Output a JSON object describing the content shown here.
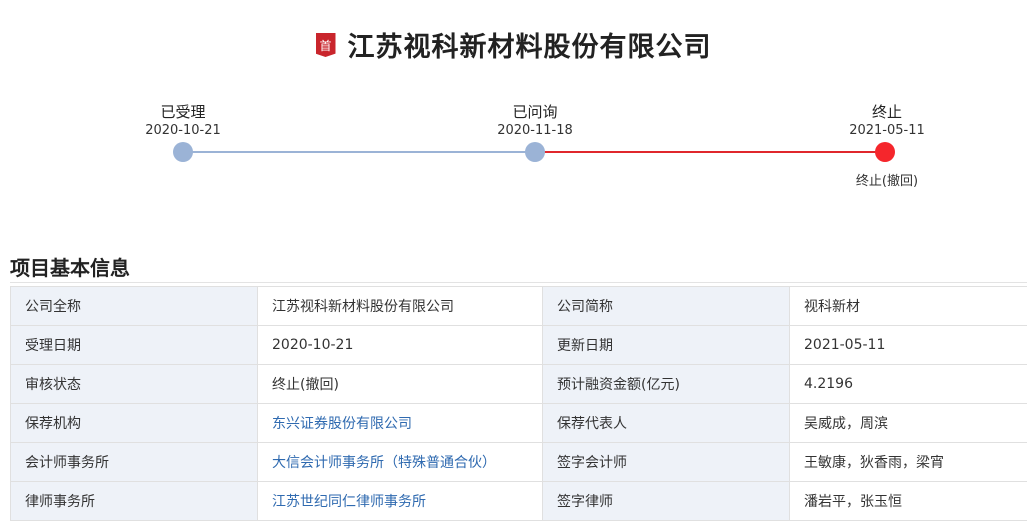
{
  "header": {
    "badge": "首",
    "title": "江苏视科新材料股份有限公司",
    "badge_color": "#c9252c"
  },
  "timeline": {
    "steps": [
      {
        "label": "已受理",
        "date": "2020-10-21",
        "note": ""
      },
      {
        "label": "已问询",
        "date": "2020-11-18",
        "note": ""
      },
      {
        "label": "终止",
        "date": "2021-05-11",
        "note": "终止(撤回)"
      }
    ],
    "colors": {
      "done": "#9bb3d6",
      "current": "#e0272c"
    }
  },
  "section": {
    "title": "项目基本信息"
  },
  "info": {
    "rows": [
      {
        "k1": "公司全称",
        "v1": "江苏视科新材料股份有限公司",
        "k2": "公司简称",
        "v2": "视科新材"
      },
      {
        "k1": "受理日期",
        "v1": "2020-10-21",
        "k2": "更新日期",
        "v2": "2021-05-11"
      },
      {
        "k1": "审核状态",
        "v1": "终止(撤回)",
        "k2": "预计融资金额(亿元)",
        "v2": "4.2196"
      },
      {
        "k1": "保荐机构",
        "v1": "东兴证券股份有限公司",
        "k2": "保荐代表人",
        "v2": "吴威成，周滨"
      },
      {
        "k1": "会计师事务所",
        "v1": "大信会计师事务所（特殊普通合伙）",
        "k2": "签字会计师",
        "v2": "王敏康，狄香雨，梁宵"
      },
      {
        "k1": "律师事务所",
        "v1": "江苏世纪同仁律师事务所",
        "k2": "签字律师",
        "v2": "潘岩平，张玉恒"
      }
    ],
    "link_color": "#2f6ab0"
  }
}
